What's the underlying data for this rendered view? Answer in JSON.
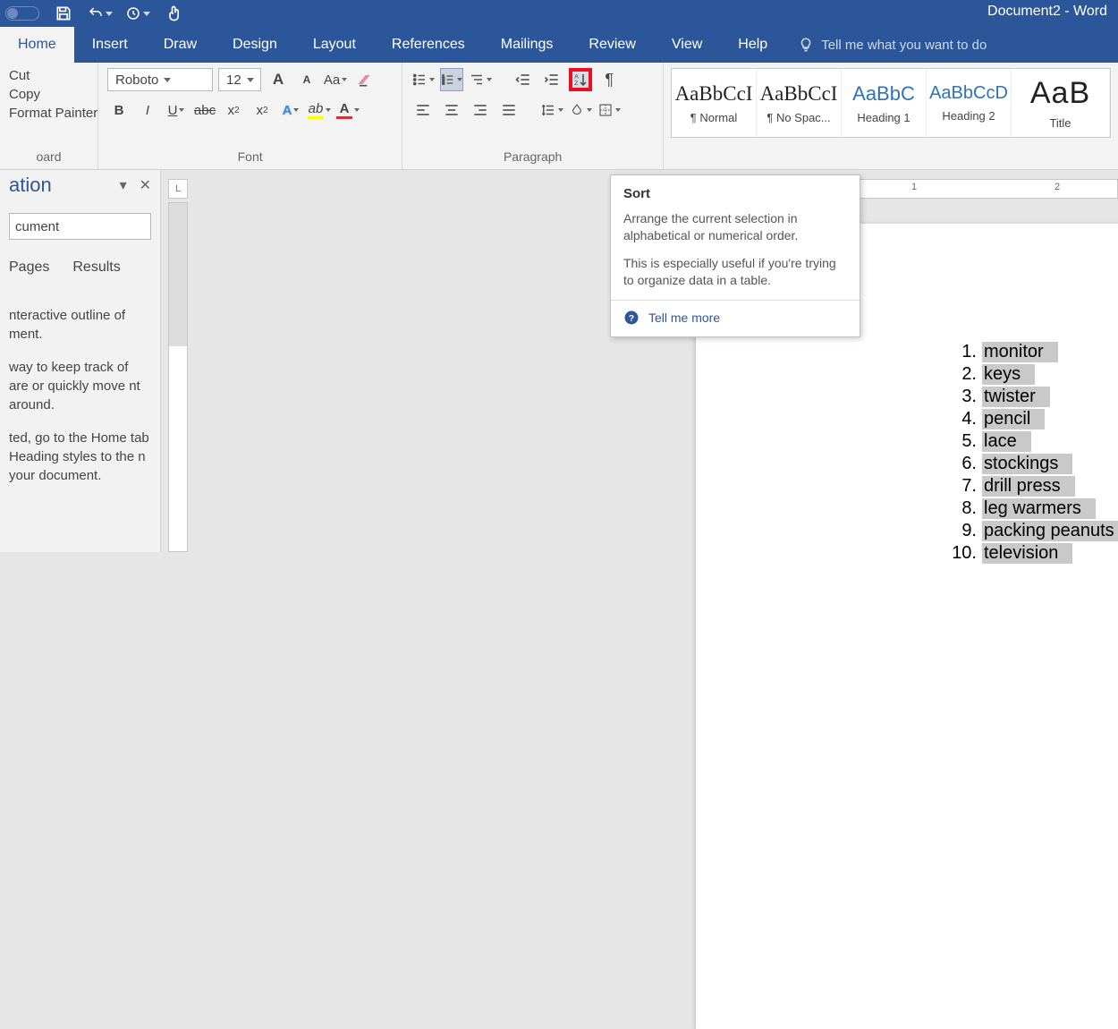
{
  "app": {
    "title": "Document2  -  Word"
  },
  "tabs": [
    "Home",
    "Insert",
    "Draw",
    "Design",
    "Layout",
    "References",
    "Mailings",
    "Review",
    "View",
    "Help"
  ],
  "tellme": {
    "placeholder": "Tell me what you want to do"
  },
  "clipboard": {
    "cut": "Cut",
    "copy": "Copy",
    "format_painter": "Format Painter",
    "group": "oard"
  },
  "font": {
    "name": "Roboto",
    "size": "12",
    "grow": "A",
    "shrink": "A",
    "case": "Aa",
    "group": "Font"
  },
  "paragraph": {
    "group": "Paragraph"
  },
  "styles": [
    {
      "sample": "AaBbCcI",
      "label": "¶ Normal",
      "cls": "normal"
    },
    {
      "sample": "AaBbCcI",
      "label": "¶ No Spac...",
      "cls": "nospace"
    },
    {
      "sample": "AaBbC",
      "label": "Heading 1",
      "cls": "h1"
    },
    {
      "sample": "AaBbCcD",
      "label": "Heading 2",
      "cls": "h2"
    },
    {
      "sample": "AaB",
      "label": "Title",
      "cls": "title"
    }
  ],
  "nav": {
    "title": "ation",
    "search_value": "cument",
    "tabs": [
      "Pages",
      "Results"
    ],
    "para1": "nteractive outline of ment.",
    "para2": "way to keep track of are or quickly move nt around.",
    "para3": "ted, go to the Home tab Heading styles to the n your document."
  },
  "tooltip": {
    "title": "Sort",
    "body1": "Arrange the current selection in alphabetical or numerical order.",
    "body2": "This is especially useful if you're trying to organize data in a table.",
    "more": "Tell me more"
  },
  "doclist": [
    "monitor",
    "keys",
    "twister",
    "pencil",
    "lace",
    "stockings",
    "drill press",
    "leg warmers",
    "packing peanuts",
    "television"
  ],
  "ruler": {
    "n1": "1",
    "n2": "2"
  }
}
